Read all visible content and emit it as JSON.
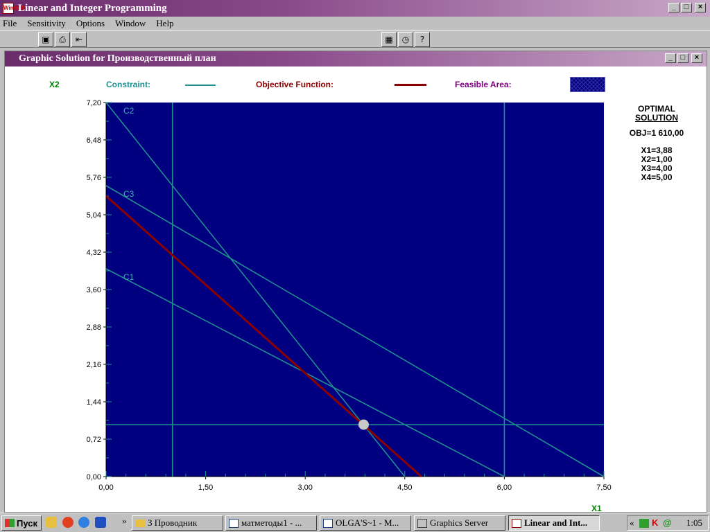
{
  "app": {
    "title": "Linear and Integer Programming",
    "icon_text": "WinQSB"
  },
  "menu": [
    "File",
    "Sensitivity",
    "Options",
    "Window",
    "Help"
  ],
  "child_window": {
    "title": "Graphic Solution for Производственный план"
  },
  "legend": {
    "y_label": "X2",
    "constraint_label": "Constraint:",
    "objective_label": "Objective Function:",
    "feasible_label": "Feasible Area:",
    "x_label": "X1",
    "colors": {
      "constraint": "#1f8f8f",
      "objective": "#8b0000",
      "feasible": "#000080",
      "plot_bg": "#000080"
    }
  },
  "optimal": {
    "title1": "OPTIMAL",
    "title2": "SOLUTION",
    "obj": "OBJ=1 610,00",
    "x1": "X1=3,88",
    "x2": "X2=1,00",
    "x3": "X3=4,00",
    "x4": "X4=5,00"
  },
  "chart_data": {
    "type": "line",
    "xlabel": "X1",
    "ylabel": "X2",
    "xlim": [
      0,
      7.5
    ],
    "ylim": [
      0,
      7.2
    ],
    "x_ticks": [
      "0,00",
      "1,50",
      "3,00",
      "4,50",
      "6,00",
      "7,50"
    ],
    "y_ticks": [
      "0,00",
      "0,72",
      "1,44",
      "2,16",
      "2,88",
      "3,60",
      "4,32",
      "5,04",
      "5,76",
      "6,48",
      "7,20"
    ],
    "constraints": [
      {
        "name": "C1",
        "points": [
          [
            0,
            4.0
          ],
          [
            6.0,
            0
          ]
        ]
      },
      {
        "name": "C2",
        "points": [
          [
            0,
            7.2
          ],
          [
            4.5,
            0
          ]
        ]
      },
      {
        "name": "C3",
        "points": [
          [
            0,
            5.6
          ],
          [
            7.5,
            0
          ]
        ]
      },
      {
        "name": "",
        "points": [
          [
            1.0,
            0
          ],
          [
            1.0,
            7.2
          ]
        ]
      },
      {
        "name": "",
        "points": [
          [
            6.0,
            0
          ],
          [
            6.0,
            7.2
          ]
        ]
      },
      {
        "name": "",
        "points": [
          [
            0,
            1.0
          ],
          [
            7.5,
            1.0
          ]
        ]
      }
    ],
    "objective": {
      "points": [
        [
          0,
          5.4
        ],
        [
          4.75,
          0
        ]
      ]
    },
    "optimal_point": [
      3.88,
      1.0
    ]
  },
  "taskbar": {
    "start": "Пуск",
    "items": [
      "3 Проводник",
      "матметоды1 - ...",
      "OLGA'S~1 - M...",
      "Graphics Server",
      "Linear and Int..."
    ],
    "clock": "1:05"
  }
}
